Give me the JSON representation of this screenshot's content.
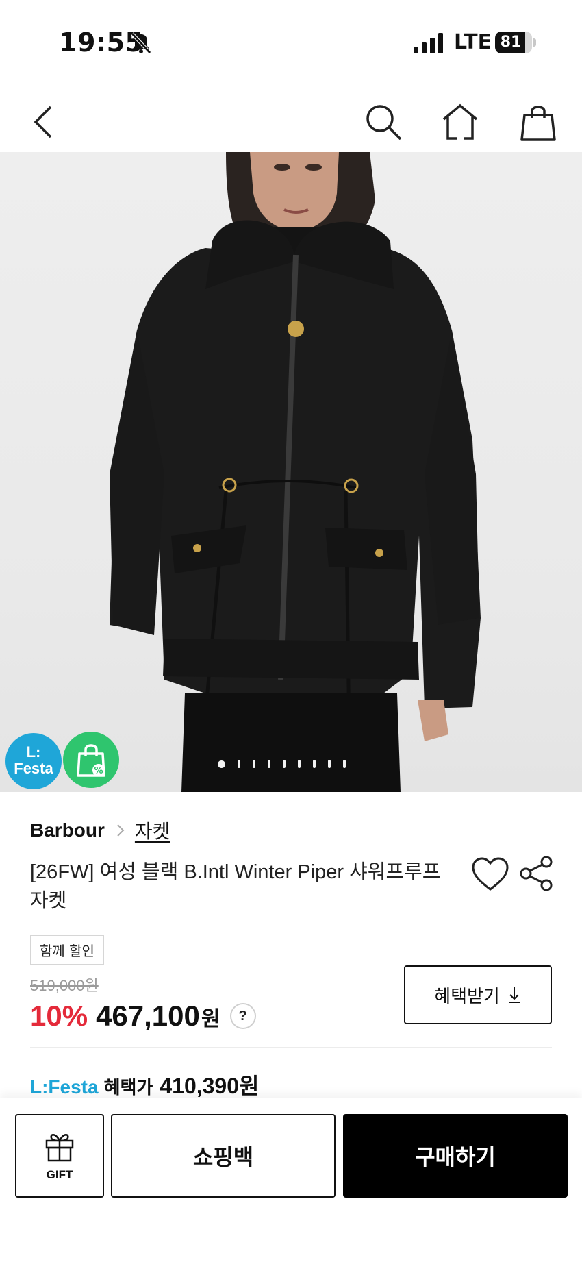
{
  "status_bar": {
    "time": "19:55",
    "network": "LTE",
    "battery": "81",
    "battery_level": 0.81
  },
  "nav": {
    "back_icon": "chevron-left-icon",
    "search_icon": "search-icon",
    "home_icon": "home-icon",
    "bag_icon": "shopping-bag-icon"
  },
  "hero": {
    "festa_badge": "L:\nFesta",
    "coupon_icon": "coupon-bag-icon",
    "carousel": {
      "total": 9,
      "current": 1
    }
  },
  "product": {
    "brand": "Barbour",
    "category": "자켓",
    "title": "[26FW] 여성 블랙 B.Intl Winter Piper 샤워프루프 자켓",
    "promo_tag": "함께 할인",
    "original_price": "519,000원",
    "discount_rate": "10%",
    "sale_price": "467,100",
    "currency": "원",
    "help": "?",
    "benefit_button": "혜택받기"
  },
  "festa": {
    "label": "L:Festa",
    "benefit_label": "혜택가",
    "benefit_price": "410,390원"
  },
  "bottom_bar": {
    "gift_label": "GIFT",
    "cart_label": "쇼핑백",
    "buy_label": "구매하기"
  },
  "colors": {
    "accent_red": "#e42a3a",
    "festa_blue": "#1fa6d8",
    "coupon_green": "#2fc56e",
    "primary_black": "#000000"
  }
}
